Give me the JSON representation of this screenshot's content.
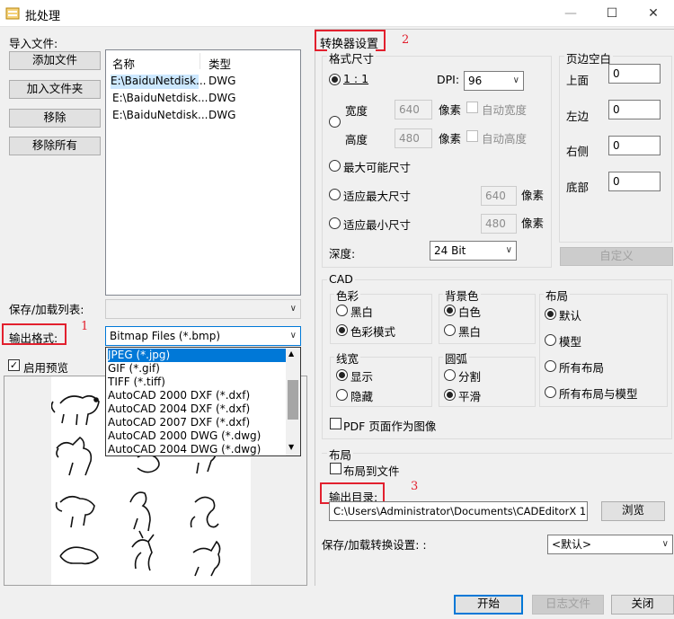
{
  "window": {
    "title": "批处理",
    "minimize": "—",
    "maximize": "☐",
    "close": "✕"
  },
  "import": {
    "group_label": "导入文件:",
    "add_file": "添加文件",
    "add_folder": "加入文件夹",
    "remove": "移除",
    "remove_all": "移除所有",
    "columns": [
      "名称",
      "类型"
    ],
    "rows": [
      {
        "name": "E:\\BaiduNetdisk...",
        "type": "DWG"
      },
      {
        "name": "E:\\BaiduNetdisk...",
        "type": "DWG"
      },
      {
        "name": "E:\\BaiduNetdisk...",
        "type": "DWG"
      }
    ]
  },
  "save_load_list": {
    "label": "保存/加载列表:",
    "value": ""
  },
  "output_format": {
    "label": "输出格式:",
    "marker": "1",
    "selected": "Bitmap Files (*.bmp)",
    "options": [
      "JPEG (*.jpg)",
      "GIF (*.gif)",
      "TIFF (*.tiff)",
      "AutoCAD 2000 DXF (*.dxf)",
      "AutoCAD 2004 DXF (*.dxf)",
      "AutoCAD 2007 DXF (*.dxf)",
      "AutoCAD 2000 DWG (*.dwg)",
      "AutoCAD 2004 DWG (*.dwg)"
    ]
  },
  "preview": {
    "label": "启用预览",
    "checked": "✓"
  },
  "converter": {
    "title": "转换器设置",
    "marker": "2",
    "format_size": {
      "title": "格式尺寸",
      "ratio": "1 : 1",
      "dpi_label": "DPI:",
      "dpi_value": "96",
      "width_label": "宽度",
      "width_value": "640",
      "height_label": "高度",
      "height_value": "480",
      "pixels": "像素",
      "auto_width": "自动宽度",
      "auto_height": "自动高度",
      "max_size": "最大可能尺寸",
      "fit_max": "适应最大尺寸",
      "fit_max_value": "640",
      "fit_min": "适应最小尺寸",
      "fit_min_value": "480",
      "depth_label": "深度:",
      "depth_value": "24 Bit"
    },
    "margins": {
      "title": "页边空白",
      "top": "上面",
      "top_value": "0",
      "left": "左边",
      "left_value": "0",
      "right": "右侧",
      "right_value": "0",
      "bottom": "底部",
      "bottom_value": "0",
      "custom": "自定义"
    },
    "cad": {
      "title": "CAD",
      "color_title": "色彩",
      "bw": "黑白",
      "color_mode": "色彩模式",
      "bg_title": "背景色",
      "white": "白色",
      "black": "黑白",
      "layout_title": "布局",
      "default": "默认",
      "model": "模型",
      "all_layouts": "所有布局",
      "all_layouts_model": "所有布局与模型",
      "lineweight_title": "线宽",
      "show": "显示",
      "hide": "隐藏",
      "arc_title": "圆弧",
      "split": "分割",
      "smooth": "平滑",
      "pdf_page_as_image": "PDF 页面作为图像"
    },
    "layout": {
      "title": "布局",
      "to_file": "布局到文件"
    },
    "output_dir": {
      "label": "输出目录:",
      "marker": "3",
      "value": "C:\\Users\\Administrator\\Documents\\CADEditorX 12\\D",
      "browse": "浏览"
    },
    "save_load_settings": {
      "label": "保存/加载转换设置: :",
      "value": "<默认>"
    }
  },
  "footer": {
    "start": "开始",
    "log": "日志文件",
    "close": "关闭"
  },
  "colors": {
    "accent": "#0078d7",
    "annotation": "#e2202e"
  }
}
